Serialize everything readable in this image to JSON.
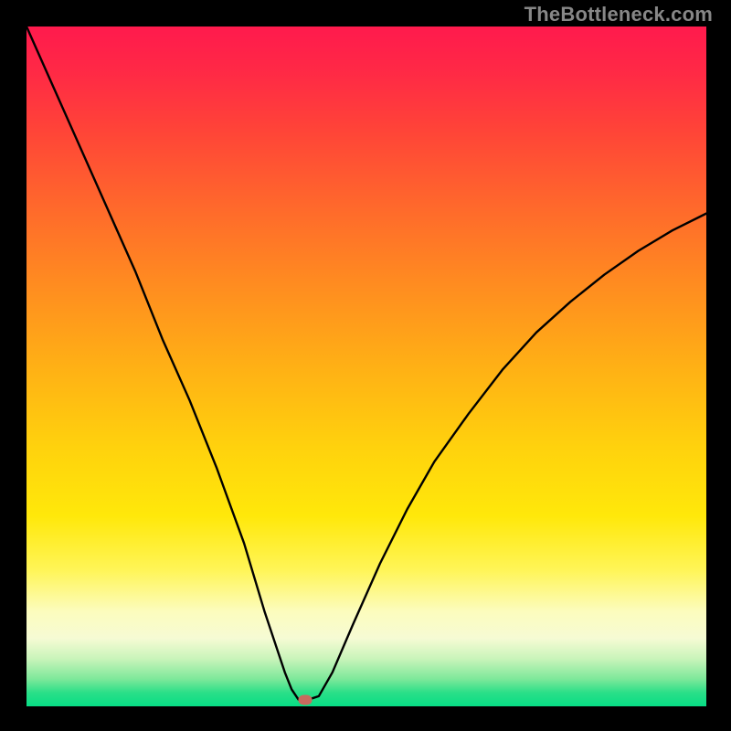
{
  "watermark": "TheBottleneck.com",
  "chart_data": {
    "type": "line",
    "title": "",
    "xlabel": "",
    "ylabel": "",
    "xlim": [
      0,
      100
    ],
    "ylim": [
      0,
      100
    ],
    "grid": false,
    "series": [
      {
        "name": "bottleneck-curve",
        "x": [
          0,
          4,
          8,
          12,
          16,
          20,
          24,
          28,
          32,
          35,
          37,
          38,
          39,
          40,
          41.5,
          43,
          45,
          48,
          52,
          56,
          60,
          65,
          70,
          75,
          80,
          85,
          90,
          95,
          100
        ],
        "values": [
          100,
          91,
          82,
          73,
          64,
          54,
          45,
          35,
          24,
          14,
          8,
          5,
          2.5,
          1,
          1,
          1.5,
          5,
          12,
          21,
          29,
          36,
          43,
          49.5,
          55,
          59.5,
          63.5,
          67,
          70,
          72.5
        ]
      }
    ],
    "marker": {
      "x": 41,
      "y": 1
    },
    "colors": {
      "curve": "#000000",
      "marker": "#c96a5e",
      "gradient_top": "#ff1a4d",
      "gradient_bottom": "#07dd85",
      "frame": "#000000"
    }
  }
}
